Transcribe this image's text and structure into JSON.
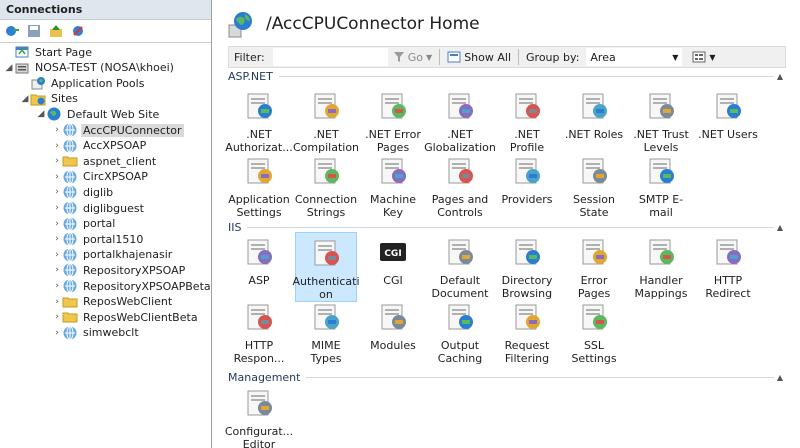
{
  "connections": {
    "header": "Connections",
    "tree": [
      {
        "label": "Start Page",
        "icon": "start-page-icon",
        "level": 0
      },
      {
        "label": "NOSA-TEST (NOSA\\khoei)",
        "icon": "server-icon",
        "level": 0,
        "expanded": true
      },
      {
        "label": "Application Pools",
        "icon": "app-pools-icon",
        "level": 1
      },
      {
        "label": "Sites",
        "icon": "sites-folder-icon",
        "level": 1,
        "expanded": true
      },
      {
        "label": "Default Web Site",
        "icon": "globe-icon",
        "level": 2,
        "expanded": true
      },
      {
        "label": "AccCPUConnector",
        "icon": "web-app-icon",
        "level": 3,
        "selected": true
      },
      {
        "label": "AccXPSOAP",
        "icon": "web-app-icon",
        "level": 3
      },
      {
        "label": "aspnet_client",
        "icon": "folder-icon",
        "level": 3
      },
      {
        "label": "CircXPSOAP",
        "icon": "web-app-icon",
        "level": 3
      },
      {
        "label": "diglib",
        "icon": "web-app-icon",
        "level": 3
      },
      {
        "label": "diglibguest",
        "icon": "web-app-icon",
        "level": 3
      },
      {
        "label": "portal",
        "icon": "web-app-icon",
        "level": 3
      },
      {
        "label": "portal1510",
        "icon": "web-app-icon",
        "level": 3
      },
      {
        "label": "portalkhajenasir",
        "icon": "web-app-icon",
        "level": 3
      },
      {
        "label": "RepositoryXPSOAP",
        "icon": "web-app-icon",
        "level": 3
      },
      {
        "label": "RepositoryXPSOAPBeta",
        "icon": "web-app-icon",
        "level": 3
      },
      {
        "label": "ReposWebClient",
        "icon": "folder-icon",
        "level": 3
      },
      {
        "label": "ReposWebClientBeta",
        "icon": "folder-icon",
        "level": 3
      },
      {
        "label": "simwebclt",
        "icon": "web-app-icon",
        "level": 3
      }
    ]
  },
  "main": {
    "title": "/AccCPUConnector Home",
    "filter_label": "Filter:",
    "go_label": "Go",
    "show_all_label": "Show All",
    "group_by_label": "Group by:",
    "group_by_value": "Area",
    "sections": [
      {
        "name": "ASP.NET",
        "features": [
          [
            ".NET",
            "Authorizat..."
          ],
          [
            ".NET",
            "Compilation"
          ],
          [
            ".NET Error",
            "Pages"
          ],
          [
            ".NET",
            "Globalization"
          ],
          [
            ".NET Profile"
          ],
          [
            ".NET Roles"
          ],
          [
            ".NET Trust",
            "Levels"
          ],
          [
            ".NET Users"
          ],
          [
            "Application",
            "Settings"
          ],
          [
            "Connection",
            "Strings"
          ],
          [
            "Machine Key"
          ],
          [
            "Pages and",
            "Controls"
          ],
          [
            "Providers"
          ],
          [
            "Session State"
          ],
          [
            "SMTP E-mail"
          ]
        ]
      },
      {
        "name": "IIS",
        "features": [
          [
            "ASP"
          ],
          [
            "Authenticati",
            "on"
          ],
          [
            "CGI"
          ],
          [
            "Default",
            "Document"
          ],
          [
            "Directory",
            "Browsing"
          ],
          [
            "Error Pages"
          ],
          [
            "Handler",
            "Mappings"
          ],
          [
            "HTTP",
            "Redirect"
          ],
          [
            "HTTP",
            "Respon..."
          ],
          [
            "MIME Types"
          ],
          [
            "Modules"
          ],
          [
            "Output",
            "Caching"
          ],
          [
            "Request",
            "Filtering"
          ],
          [
            "SSL Settings"
          ]
        ]
      },
      {
        "name": "Management",
        "features": [
          [
            "Configurat...",
            "Editor"
          ]
        ]
      }
    ]
  },
  "colors": {
    "accent": "#1e395b",
    "selection": "#cce8ff",
    "selection_border": "#99d1ff",
    "header_bg": "#dfe6ee"
  }
}
